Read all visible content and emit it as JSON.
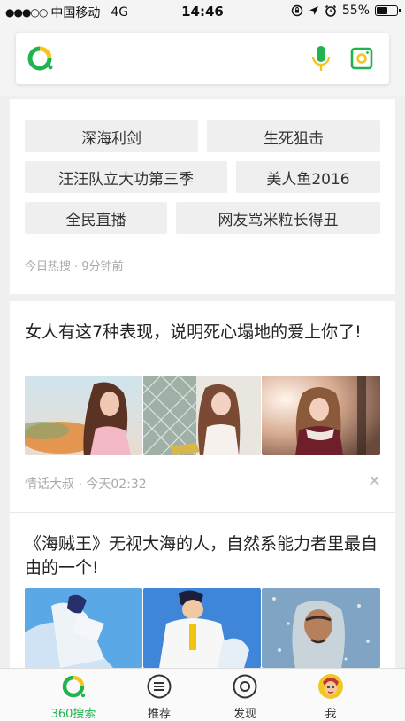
{
  "status_bar": {
    "carrier": "中国移动",
    "network": "4G",
    "time": "14:46",
    "battery": "55%",
    "battery_level": 0.55
  },
  "search": {
    "logo_icon": "360-logo-icon",
    "mic_icon": "microphone-icon",
    "camera_icon": "camera-scan-icon"
  },
  "hot_search": {
    "items": [
      "深海利剑",
      "生死狙击",
      "汪汪队立大功第三季",
      "美人鱼2016",
      "全民直播",
      "网友骂米粒长得丑"
    ],
    "meta": "今日热搜 · 9分钟前"
  },
  "feed": [
    {
      "title": "女人有这7种表现，说明死心塌地的爱上你了!",
      "meta": "情话大叔 · 今天02:32",
      "dismiss": "✕"
    },
    {
      "title": "《海贼王》无视大海的人，自然系能力者里最自由的一个!"
    }
  ],
  "tabs": [
    {
      "label": "360搜索",
      "icon": "360-logo-icon",
      "active": true
    },
    {
      "label": "推荐",
      "icon": "list-icon"
    },
    {
      "label": "发现",
      "icon": "discover-icon"
    },
    {
      "label": "我",
      "icon": "avatar-icon"
    }
  ],
  "colors": {
    "brand_green": "#20b34e",
    "brand_yellow": "#f7c51e"
  }
}
